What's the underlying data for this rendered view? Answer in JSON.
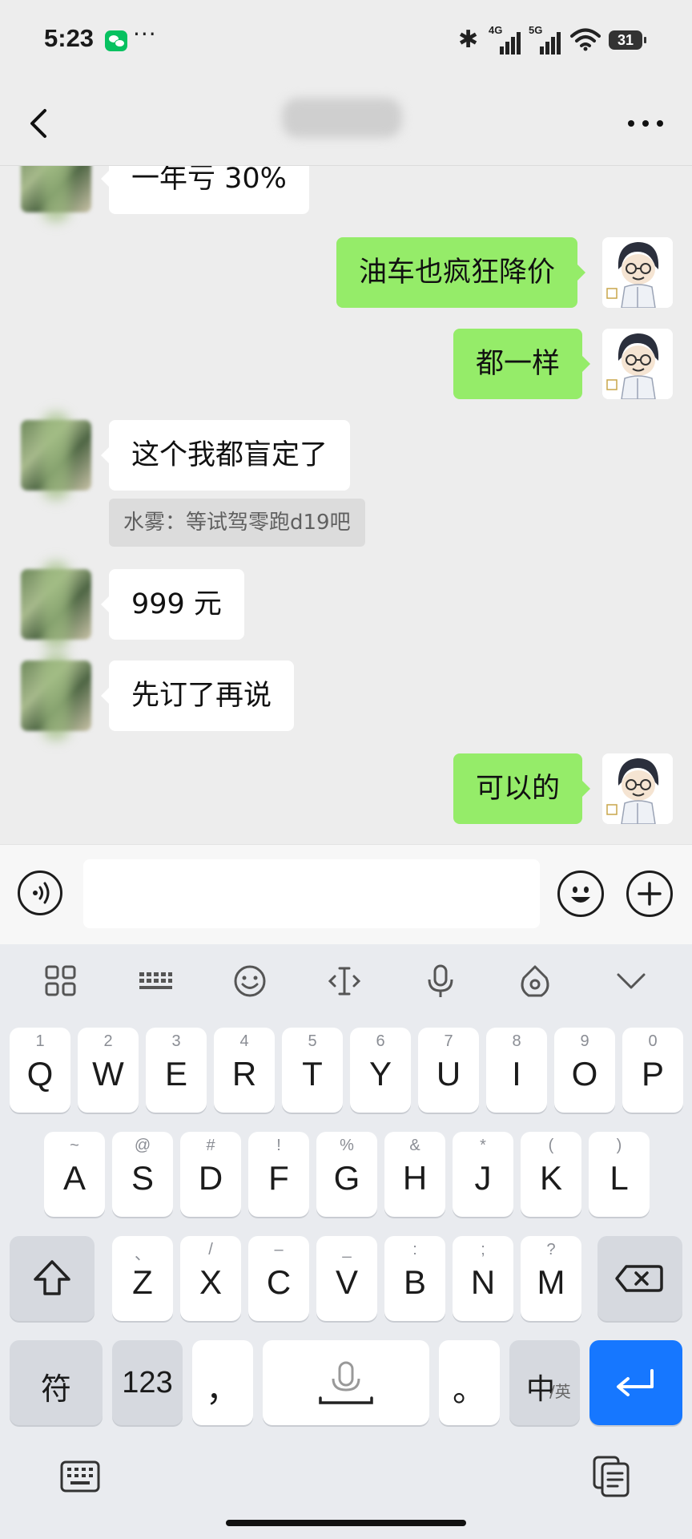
{
  "status_bar": {
    "time": "5:23",
    "dots": "···",
    "sig1": "4G",
    "sig2": "5G",
    "battery": "31"
  },
  "nav": {
    "title": "",
    "back_icon": "chevron-left-icon",
    "more_icon": "more-horizontal-icon"
  },
  "messages": [
    {
      "side": "left",
      "text": "一年亏 30%"
    },
    {
      "side": "right",
      "text": "油车也疯狂降价"
    },
    {
      "side": "right",
      "text": "都一样"
    },
    {
      "side": "left",
      "text": "这个我都盲定了",
      "quote": "水雾：等试驾零跑d19吧"
    },
    {
      "side": "left",
      "text": "999 元"
    },
    {
      "side": "left",
      "text": "先订了再说"
    },
    {
      "side": "right",
      "text": "可以的"
    }
  ],
  "input": {
    "value": "",
    "voice_icon": "voice-icon",
    "mic_icon": "mic-icon",
    "emoji_icon": "emoji-icon",
    "plus_icon": "plus-icon"
  },
  "keyboard": {
    "toolbar": [
      "grid-icon",
      "keyboard-icon",
      "smile-icon",
      "cursor-icon",
      "mic-icon",
      "theme-icon",
      "chevron-down-icon"
    ],
    "row1": [
      {
        "main": "Q",
        "sub": "1"
      },
      {
        "main": "W",
        "sub": "2"
      },
      {
        "main": "E",
        "sub": "3"
      },
      {
        "main": "R",
        "sub": "4"
      },
      {
        "main": "T",
        "sub": "5"
      },
      {
        "main": "Y",
        "sub": "6"
      },
      {
        "main": "U",
        "sub": "7"
      },
      {
        "main": "I",
        "sub": "8"
      },
      {
        "main": "O",
        "sub": "9"
      },
      {
        "main": "P",
        "sub": "0"
      }
    ],
    "row2": [
      {
        "main": "A",
        "sub": "~"
      },
      {
        "main": "S",
        "sub": "@"
      },
      {
        "main": "D",
        "sub": "#"
      },
      {
        "main": "F",
        "sub": "!"
      },
      {
        "main": "G",
        "sub": "%"
      },
      {
        "main": "H",
        "sub": "&"
      },
      {
        "main": "J",
        "sub": "*"
      },
      {
        "main": "K",
        "sub": "("
      },
      {
        "main": "L",
        "sub": ")"
      }
    ],
    "row3": [
      {
        "main": "Z",
        "sub": "、"
      },
      {
        "main": "X",
        "sub": "/"
      },
      {
        "main": "C",
        "sub": "–"
      },
      {
        "main": "V",
        "sub": "_"
      },
      {
        "main": "B",
        "sub": ":"
      },
      {
        "main": "N",
        "sub": ";"
      },
      {
        "main": "M",
        "sub": "?"
      }
    ],
    "symbols_label": "符",
    "numbers_label": "123",
    "comma_label": "，",
    "period_label": "。",
    "lang_main": "中",
    "lang_sub": "/英",
    "bottom_left_icon": "keyboard-icon",
    "bottom_right_icon": "clipboard-icon"
  }
}
